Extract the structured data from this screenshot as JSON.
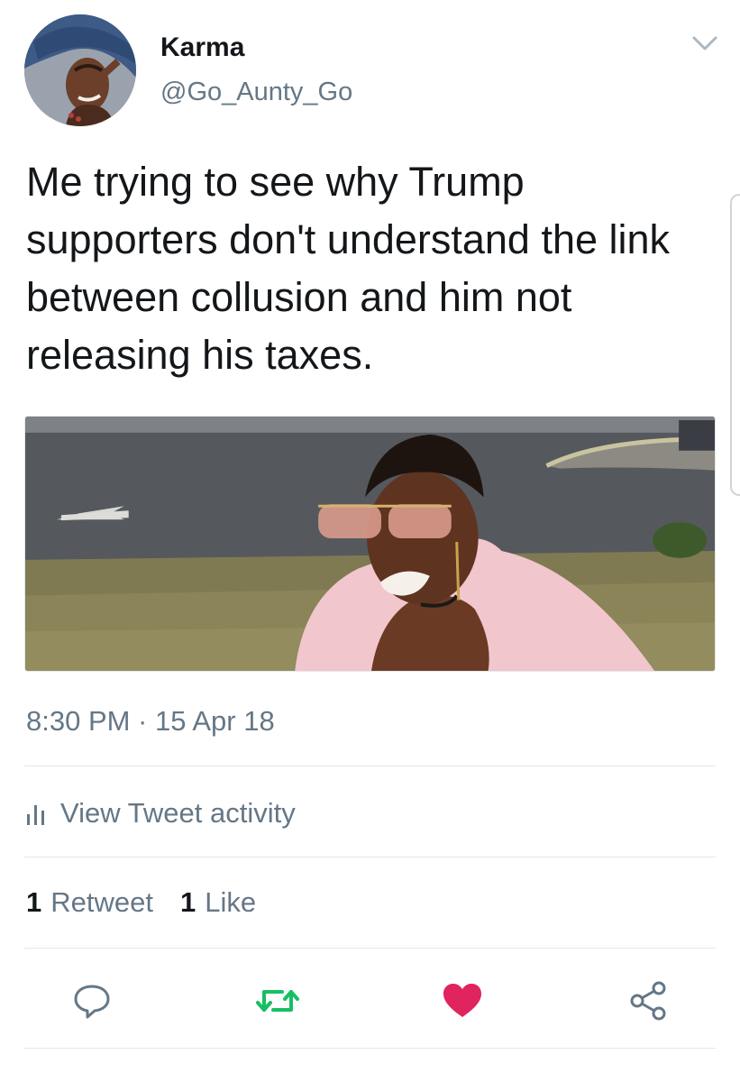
{
  "tweet": {
    "author": {
      "display_name": "Karma",
      "handle": "@Go_Aunty_Go"
    },
    "text": "Me trying to see why Trump supporters don't understand the link between collusion and him not releasing his taxes.",
    "timestamp": "8:30 PM · 15 Apr 18",
    "activity_label": "View Tweet activity",
    "stats": {
      "retweets": {
        "count": "1",
        "label": "Retweet"
      },
      "likes": {
        "count": "1",
        "label": "Like"
      }
    },
    "actions": {
      "reply_icon": "speech-bubble-icon",
      "retweet_icon": "retweet-arrows-icon",
      "like_icon": "heart-icon",
      "share_icon": "share-nodes-icon"
    },
    "liked": true
  },
  "colors": {
    "text_primary": "#14171a",
    "text_secondary": "#657786",
    "divider": "#e1e8ed",
    "retweet_green": "#17bf63",
    "like_red": "#e0245e",
    "icon_gray": "#657786"
  }
}
